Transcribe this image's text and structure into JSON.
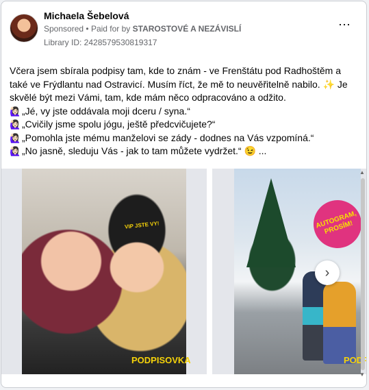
{
  "post": {
    "author": "Michaela Šebelová",
    "sponsored": "Sponsored",
    "paid_prefix": "Paid for by",
    "payer": "STAROSTOVÉ A NEZÁVISLÍ",
    "library_id": "Library ID: 2428579530819317",
    "more_icon": "⋯",
    "text_main": "Včera jsem sbírala podpisy tam, kde to znám - ve Frenštátu pod Radhoštěm a také ve Frýdlantu nad Ostravicí. Musím říct, že mě to neuvěřitelně nabilo. ✨  Je skvělé být mezi Vámi, tam, kde mám něco odpracováno a odžito.",
    "quotes": [
      {
        "emoji": "🙋🏻‍♀️",
        "text": "„Jé, vy jste oddávala moji dceru / syna.“"
      },
      {
        "emoji": "🙋🏻‍♀️",
        "text": "„Cvičily jsme spolu jógu, ještě předcvičujete?“"
      },
      {
        "emoji": "🙋🏻‍♀️",
        "text": "„Pomohla jste mému manželovi se zády - dodnes na Vás vzpomíná.“"
      },
      {
        "emoji": "🙋🏻‍♀️",
        "text": "„No jasně, sleduju Vás - jak to tam můžete vydržet.“ 😉 ..."
      }
    ]
  },
  "gallery": {
    "slide1_caption": "PODPISOVKA",
    "slide1_hat": "VIP JSTE VY!",
    "slide2_badge": "AUTOGRAM, PROSÍM!",
    "slide2_caption": "PODPI",
    "next_icon": "›"
  }
}
